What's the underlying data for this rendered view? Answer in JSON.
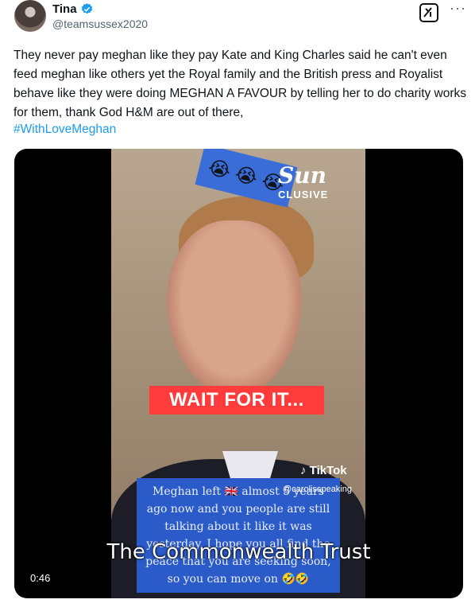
{
  "author": {
    "name": "Tina",
    "handle": "@teamsussex2020"
  },
  "tweet": {
    "text": "They never pay meghan like they pay Kate and King Charles said he can't even feed meghan like others yet the Royal family and the British press and Royalist behave like they were doing MEGHAN A FAVOUR by telling her to do charity works for them, thank God H&M are out of there,",
    "hashtag": "#WithLoveMeghan"
  },
  "video": {
    "logo_brand": "Sun",
    "logo_sub": "CLUSIVE",
    "emoji_banner": "😭 😭 😭",
    "wait_text": "WAIT FOR IT...",
    "tiktok_label": "TikTok",
    "tiktok_handle": "@carolisspeaking",
    "caption": "Meghan left 🇬🇧 almost 5 years ago now and you people are still talking about it like it was yesterday, I hope you all find the peace that you are seeking soon, so you can move on 🤣🤣",
    "subtitle": "The Commonwealth Trust",
    "duration": "0:46"
  },
  "colors": {
    "link": "#1d9bf0",
    "verified": "#1d9bf0",
    "caption_bg": "#2b5bc9",
    "wait_bg": "#ff3b3b"
  },
  "icons": {
    "verified": "verified-badge-icon",
    "grok": "grok-icon",
    "more": "more-icon",
    "tiktok": "tiktok-icon"
  }
}
